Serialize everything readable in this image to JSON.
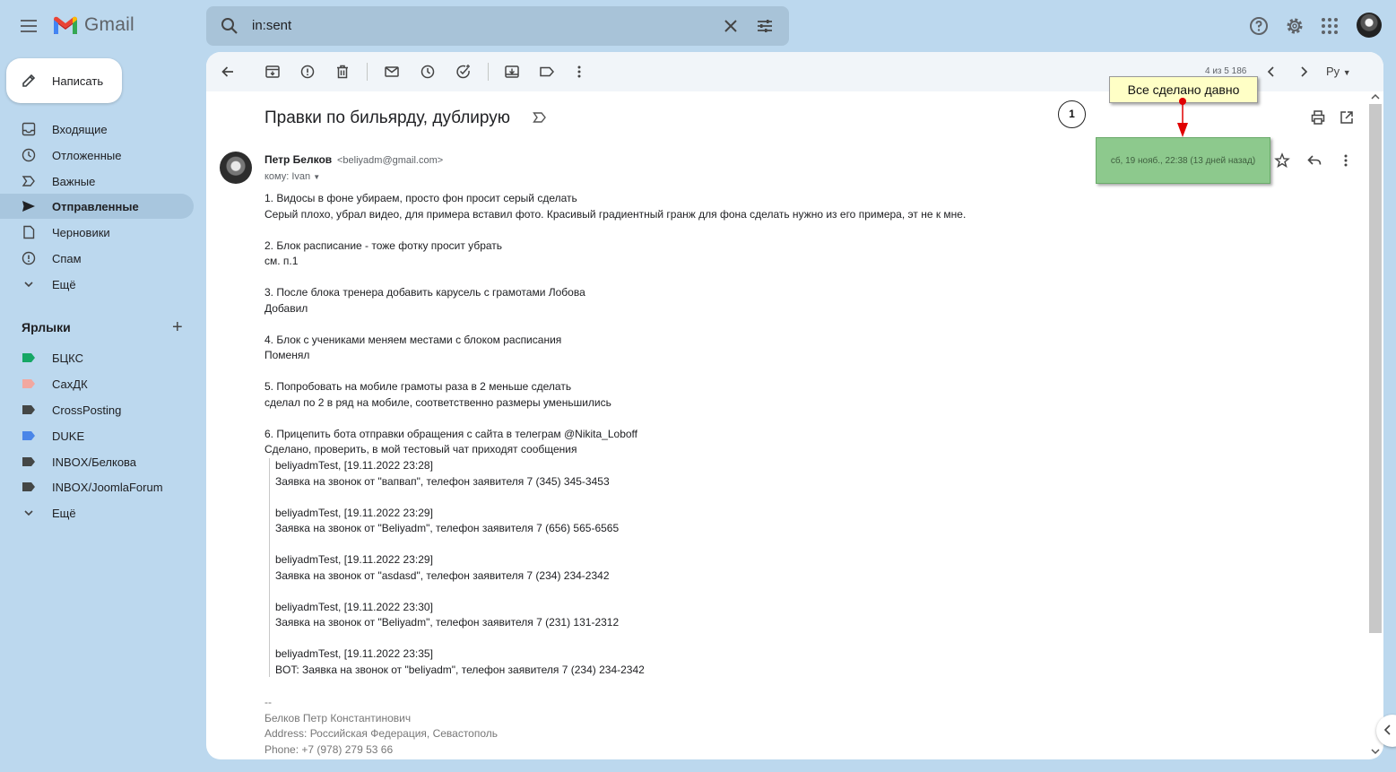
{
  "app": {
    "name": "Gmail"
  },
  "search": {
    "query": "in:sent"
  },
  "compose": {
    "label": "Написать"
  },
  "sidebar": {
    "items": [
      {
        "label": "Входящие",
        "icon": "inbox-icon"
      },
      {
        "label": "Отложенные",
        "icon": "clock-icon"
      },
      {
        "label": "Важные",
        "icon": "important-icon"
      },
      {
        "label": "Отправленные",
        "icon": "send-icon",
        "active": true
      },
      {
        "label": "Черновики",
        "icon": "draft-icon"
      },
      {
        "label": "Спам",
        "icon": "spam-icon"
      },
      {
        "label": "Ещё",
        "icon": "chevron-down-icon"
      }
    ],
    "labels_title": "Ярлыки",
    "labels": [
      {
        "label": "БЦКС",
        "color": "#16a765"
      },
      {
        "label": "СахДК",
        "color": "#f2a8a0"
      },
      {
        "label": "CrossPosting",
        "color": "#444746"
      },
      {
        "label": "DUKE",
        "color": "#4a86e8"
      },
      {
        "label": "INBOX/Белкова",
        "color": "#444746"
      },
      {
        "label": "INBOX/JoomlaForum",
        "color": "#444746"
      }
    ],
    "labels_more": "Ещё"
  },
  "toolbar": {
    "pager": "4 из 5 186",
    "lang": "Ру"
  },
  "message": {
    "subject": "Правки по бильярду, дублирую",
    "badge_number": "1",
    "sender_name": "Петр Белков",
    "sender_email": "<beliyadm@gmail.com>",
    "recipient": "кому: Ivan",
    "date": "сб, 19 нояб., 22:38 (13 дней назад)",
    "callout": "Все сделано давно",
    "body_lines": [
      "1. Видосы в фоне убираем, просто фон просит серый сделать",
      "Серый плохо, убрал видео, для примера вставил фото. Красивый градиентный гранж для фона сделать нужно из его примера, эт не к мне.",
      "",
      "2. Блок расписание - тоже фотку просит убрать",
      "см. п.1",
      "",
      "3. После блока тренера добавить карусель с грамотами Лобова",
      "Добавил",
      "",
      "4. Блок с учениками меняем местами с блоком расписания",
      "Поменял",
      "",
      "5. Попробовать на мобиле грамоты раза в 2 меньше сделать",
      "сделал по 2 в ряд на мобиле, соответственно размеры уменьшились",
      "",
      "6. Прицепить бота отправки обращения с сайта в телеграм @Nikita_Loboff",
      "Сделано, проверить, в мой тестовый чат приходят сообщения"
    ],
    "quote_lines": [
      "beliyadmTest, [19.11.2022 23:28]",
      "Заявка на звонок от \"вапвап\", телефон заявителя  7 (345) 345-3453",
      "",
      "beliyadmTest, [19.11.2022 23:29]",
      "Заявка на звонок от \"Beliyadm\", телефон заявителя  7 (656) 565-6565",
      "",
      "beliyadmTest, [19.11.2022 23:29]",
      "Заявка на звонок от \"asdasd\", телефон заявителя  7 (234) 234-2342",
      "",
      "beliyadmTest, [19.11.2022 23:30]",
      "Заявка на звонок от \"Beliyadm\", телефон заявителя  7 (231) 131-2312",
      "",
      "beliyadmTest, [19.11.2022 23:35]",
      "BOT: Заявка на звонок от \"beliyadm\", телефон заявителя  7 (234) 234-2342"
    ],
    "signature_lines": [
      "--",
      "Белков Петр Константинович",
      "Address: Российская Федерация, Севастополь",
      "Phone: +7 (978) 279 53 66"
    ]
  }
}
